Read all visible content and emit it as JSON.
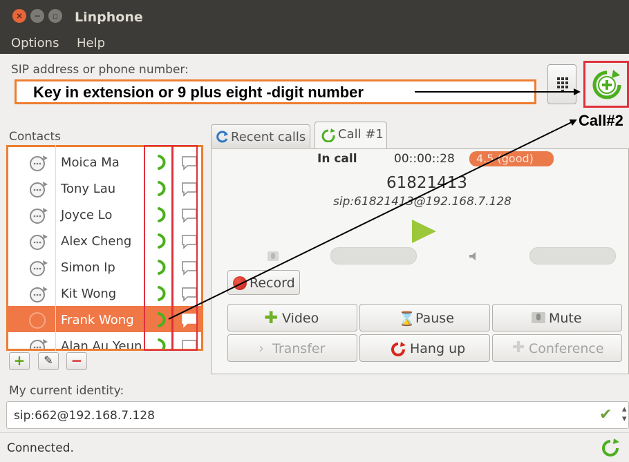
{
  "window": {
    "title": "Linphone",
    "controls": [
      "close-icon",
      "minimize-icon",
      "maximize-icon"
    ]
  },
  "menu": {
    "options": "Options",
    "help": "Help"
  },
  "sip": {
    "label": "SIP address or phone number:",
    "value": "Key in extension or 9 plus eight -digit number",
    "dialpad_icon": "dialpad-icon",
    "call_icon": "start-call-icon",
    "call_annotation": "Call#2"
  },
  "contacts": {
    "label": "Contacts",
    "items": [
      {
        "name": "Moica Ma",
        "selected": false
      },
      {
        "name": "Tony Lau",
        "selected": false
      },
      {
        "name": "Joyce Lo",
        "selected": false
      },
      {
        "name": "Alex Cheng",
        "selected": false
      },
      {
        "name": "Simon Ip",
        "selected": false
      },
      {
        "name": "Kit Wong",
        "selected": false
      },
      {
        "name": "Frank Wong",
        "selected": true
      },
      {
        "name": "Alan Au Yeun",
        "selected": false
      }
    ],
    "buttons": {
      "add": "+",
      "edit": "✎",
      "remove": "−"
    }
  },
  "tabs": {
    "recent": "Recent calls",
    "call1": "Call #1"
  },
  "call": {
    "state": "In call",
    "duration": "00::00::28",
    "quality": "4.5 (good)",
    "number": "61821413",
    "sip_uri": "sip:61821413@192.168.7.128",
    "buttons": {
      "record": "Record",
      "video": "Video",
      "pause": "Pause",
      "mute": "Mute",
      "transfer": "Transfer",
      "hangup": "Hang up",
      "conference": "Conference"
    }
  },
  "identity": {
    "label": "My current identity:",
    "value": "sip:662@192.168.7.128"
  },
  "status": {
    "text": "Connected."
  },
  "colors": {
    "accent_orange": "#ed7d31",
    "highlight_red": "#e0303c",
    "call_green": "#4caf1e",
    "titlebar": "#3c3b37"
  }
}
